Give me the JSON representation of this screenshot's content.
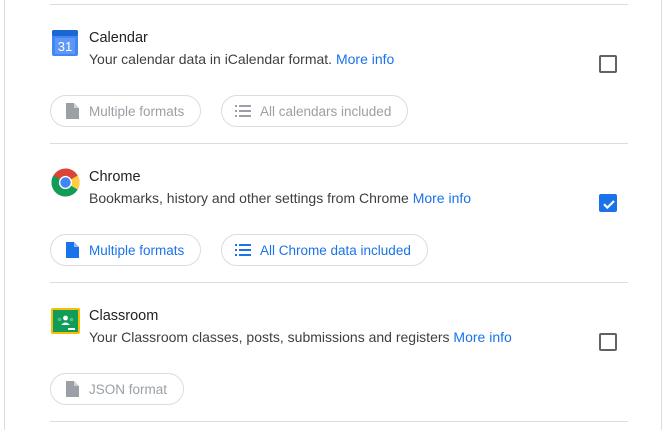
{
  "products": [
    {
      "title": "Calendar",
      "description": "Your calendar data in iCalendar format.",
      "link_label": "More info",
      "checked": false,
      "logo": "calendar-icon",
      "logo_text": "31",
      "chips": [
        {
          "label": "Multiple formats",
          "icon": "file-icon"
        },
        {
          "label": "All calendars included",
          "icon": "list-icon"
        }
      ],
      "chips_enabled": false
    },
    {
      "title": "Chrome",
      "description": "Bookmarks, history and other settings from Chrome",
      "link_label": "More info",
      "checked": true,
      "logo": "chrome-icon",
      "chips": [
        {
          "label": "Multiple formats",
          "icon": "file-icon"
        },
        {
          "label": "All Chrome data included",
          "icon": "list-icon"
        }
      ],
      "chips_enabled": true
    },
    {
      "title": "Classroom",
      "description": "Your Classroom classes, posts, submissions and registers",
      "link_label": "More info",
      "checked": false,
      "logo": "classroom-icon",
      "chips": [
        {
          "label": "JSON format",
          "icon": "file-icon"
        }
      ],
      "chips_enabled": false
    }
  ],
  "colors": {
    "accent": "#1a73e8",
    "disabled": "#9aa0a6",
    "divider": "#dadce0"
  }
}
